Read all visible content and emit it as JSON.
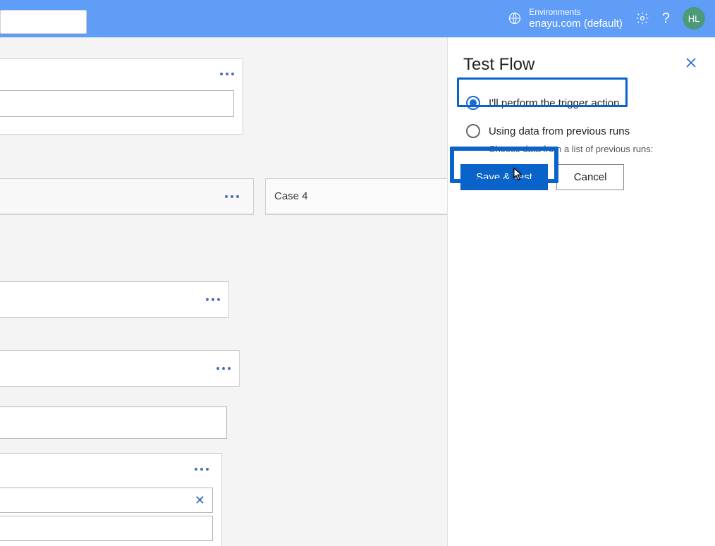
{
  "header": {
    "env_label": "Environments",
    "env_name": "enayu.com (default)",
    "avatar_initials": "HL"
  },
  "canvas": {
    "card3_title": "Case 4"
  },
  "panel": {
    "title": "Test Flow",
    "radio1_label": "I'll perform the trigger action",
    "radio2_label": "Using data from previous runs",
    "hint": "Choose data from a list of previous runs:",
    "save_test_label": "Save & Test",
    "cancel_label": "Cancel"
  }
}
